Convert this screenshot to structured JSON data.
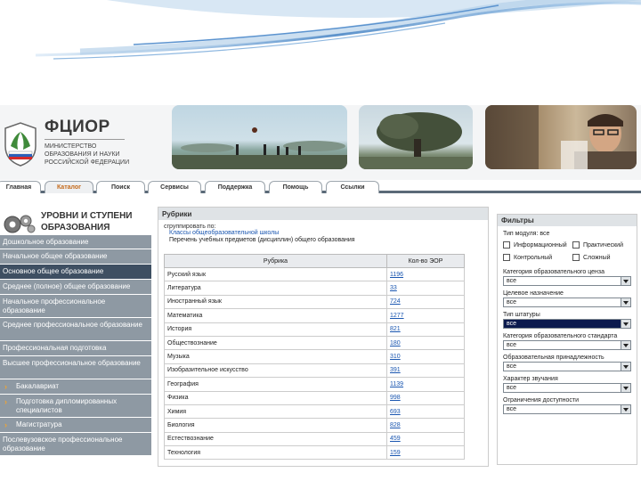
{
  "header": {
    "logo_title": "ФЦИОР",
    "logo_subtitle": "МИНИСТЕРСТВО ОБРАЗОВАНИЯ И НАУКИ РОССИЙСКОЙ ФЕДЕРАЦИИ"
  },
  "tabs": [
    {
      "label": "Главная"
    },
    {
      "label": "Каталог"
    },
    {
      "label": "Поиск"
    },
    {
      "label": "Сервисы"
    },
    {
      "label": "Поддержка"
    },
    {
      "label": "Помощь"
    },
    {
      "label": "Ссылки"
    }
  ],
  "sidebar": {
    "title_line1": "УРОВНИ И СТУПЕНИ",
    "title_line2": "ОБРАЗОВАНИЯ",
    "items": [
      {
        "label": "Дошкольное образование"
      },
      {
        "label": "Начальное общее образование"
      },
      {
        "label": "Основное общее образование"
      },
      {
        "label": "Среднее (полное) общее образование"
      },
      {
        "label": "Начальное профессиональное образование"
      },
      {
        "label": "Среднее профессиональное образование"
      },
      {
        "label": "Профессиональная подготовка"
      },
      {
        "label": "Высшее профессиональное образование"
      },
      {
        "label": "Бакалавриат"
      },
      {
        "label": "Подготовка дипломированных специалистов"
      },
      {
        "label": "Магистратура"
      },
      {
        "label": "Послевузовское профессиональное образование"
      }
    ]
  },
  "rubrics": {
    "title": "Рубрики",
    "group_label": "сгруппировать по:",
    "group_link": "Классы общеобразовательной школы",
    "group_selected": "Перечень учебных предметов (дисциплин) общего образования",
    "col_rubric": "Рубрика",
    "col_count": "Кол-во ЭОР",
    "rows": [
      {
        "name": "Русский язык",
        "count": "1196"
      },
      {
        "name": "Литература",
        "count": "33"
      },
      {
        "name": "Иностранный язык",
        "count": "724"
      },
      {
        "name": "Математика",
        "count": "1277"
      },
      {
        "name": "История",
        "count": "821"
      },
      {
        "name": "Обществознание",
        "count": "180"
      },
      {
        "name": "Музыка",
        "count": "310"
      },
      {
        "name": "Изобразительное искусство",
        "count": "391"
      },
      {
        "name": "География",
        "count": "1139"
      },
      {
        "name": "Физика",
        "count": "998"
      },
      {
        "name": "Химия",
        "count": "693"
      },
      {
        "name": "Биология",
        "count": "828"
      },
      {
        "name": "Естествознание",
        "count": "459"
      },
      {
        "name": "Технология",
        "count": "159"
      }
    ]
  },
  "filters": {
    "title": "Фильтры",
    "module_type_label": "Тип модуля: все",
    "checks": [
      {
        "label": "Информационный"
      },
      {
        "label": "Практический"
      },
      {
        "label": "Контрольный"
      },
      {
        "label": "Сложный"
      }
    ],
    "fields": [
      {
        "label": "Категория образовательного ценза",
        "value": "все"
      },
      {
        "label": "Целевое назначение",
        "value": "все"
      },
      {
        "label": "Тип штатуры",
        "value": "все"
      },
      {
        "label": "Категория образовательного стандарта",
        "value": "все"
      },
      {
        "label": "Образовательная принадлежность",
        "value": "все"
      },
      {
        "label": "Характер звучания",
        "value": "все"
      },
      {
        "label": "Ограничения доступности",
        "value": "все"
      }
    ]
  }
}
